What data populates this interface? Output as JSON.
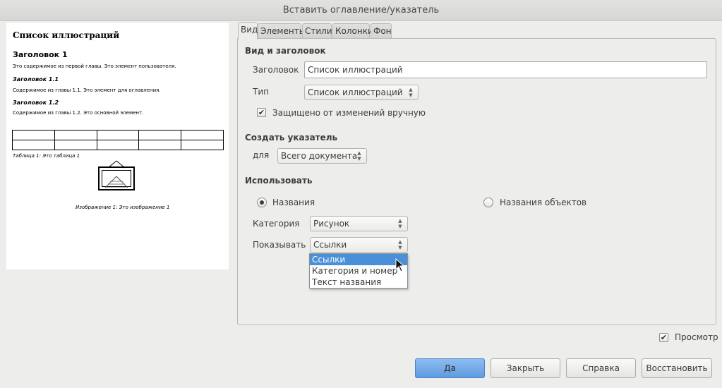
{
  "window": {
    "title": "Вставить оглавление/указатель"
  },
  "preview": {
    "title": "Список иллюстраций",
    "heading1": "Заголовок 1",
    "heading1_text": "Это содержимое из первой главы. Это элемент пользователя.",
    "heading11": "Заголовок 1.1",
    "heading11_text": "Содержимое из главы 1.1. Это элемент для оглавления.",
    "heading12": "Заголовок 1.2",
    "heading12_text": "Содержимое из главы 1.2. Это основной элемент.",
    "table_caption": "Таблица 1: Это таблица 1",
    "image_caption": "Изображение 1: Это изображение 1"
  },
  "tabs": [
    "Вид",
    "Элементы",
    "Стили",
    "Колонки",
    "Фон"
  ],
  "type_section": {
    "header": "Вид и заголовок",
    "title_label": "Заголовок",
    "title_value": "Список иллюстраций",
    "type_label": "Тип",
    "type_value": "Список иллюстраций",
    "protected_label": "Защищено от изменений вручную",
    "protected_checked": true
  },
  "create_section": {
    "header": "Создать указатель",
    "for_label": "для",
    "for_value": "Всего документа"
  },
  "use_section": {
    "header": "Использовать",
    "captions_label": "Названия",
    "object_names_label": "Названия объектов",
    "selected": "captions",
    "category_label": "Категория",
    "category_value": "Рисунок",
    "display_label": "Показывать",
    "display_value": "Ссылки",
    "display_options": [
      "Ссылки",
      "Категория и номер",
      "Текст названия"
    ],
    "display_highlighted": "Ссылки"
  },
  "preview_toggle": {
    "label": "Просмотр",
    "checked": true
  },
  "buttons": {
    "ok": "Да",
    "close": "Закрыть",
    "help": "Справка",
    "reset": "Восстановить"
  },
  "colors": {
    "accent": "#4a90d9",
    "background": "#ededec"
  }
}
